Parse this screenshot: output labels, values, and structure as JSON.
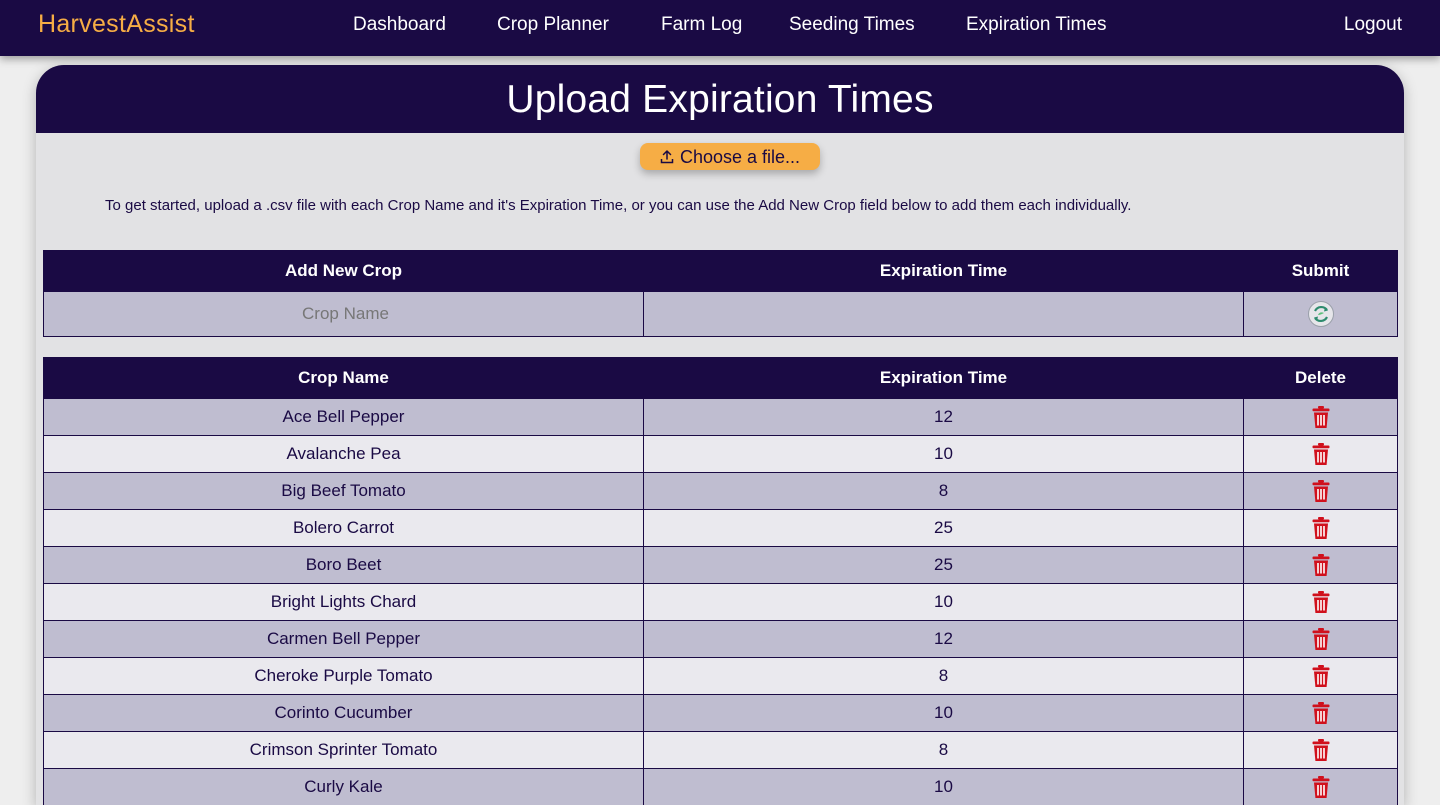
{
  "nav": {
    "brand": "HarvestAssist",
    "links": [
      "Dashboard",
      "Crop Planner",
      "Farm Log",
      "Seeding Times",
      "Expiration Times"
    ],
    "logout": "Logout"
  },
  "page": {
    "title": "Upload Expiration Times",
    "file_button": "Choose a file...",
    "intro": "To get started, upload a .csv file with each Crop Name and it's Expiration Time, or you can use the Add New Crop field below to add them each individually."
  },
  "add_form": {
    "headers": [
      "Add New Crop",
      "Expiration Time",
      "Submit"
    ],
    "crop_placeholder": "Crop Name",
    "expiration_value": ""
  },
  "crop_table": {
    "headers": [
      "Crop Name",
      "Expiration Time",
      "Delete"
    ],
    "rows": [
      {
        "name": "Ace Bell Pepper",
        "time": "12"
      },
      {
        "name": "Avalanche Pea",
        "time": "10"
      },
      {
        "name": "Big Beef Tomato",
        "time": "8"
      },
      {
        "name": "Bolero Carrot",
        "time": "25"
      },
      {
        "name": "Boro Beet",
        "time": "25"
      },
      {
        "name": "Bright Lights Chard",
        "time": "10"
      },
      {
        "name": "Carmen Bell Pepper",
        "time": "12"
      },
      {
        "name": "Cheroke Purple Tomato",
        "time": "8"
      },
      {
        "name": "Corinto Cucumber",
        "time": "10"
      },
      {
        "name": "Crimson Sprinter Tomato",
        "time": "8"
      },
      {
        "name": "Curly Kale",
        "time": "10"
      }
    ]
  },
  "colors": {
    "navy": "#1a0a44",
    "accent": "#f6ad45",
    "row_odd": "#bfbdd0",
    "row_even": "#eae9ee",
    "delete_red": "#d0101c"
  },
  "icons": {
    "upload": "upload-icon",
    "submit": "refresh-icon",
    "delete": "trash-icon"
  }
}
